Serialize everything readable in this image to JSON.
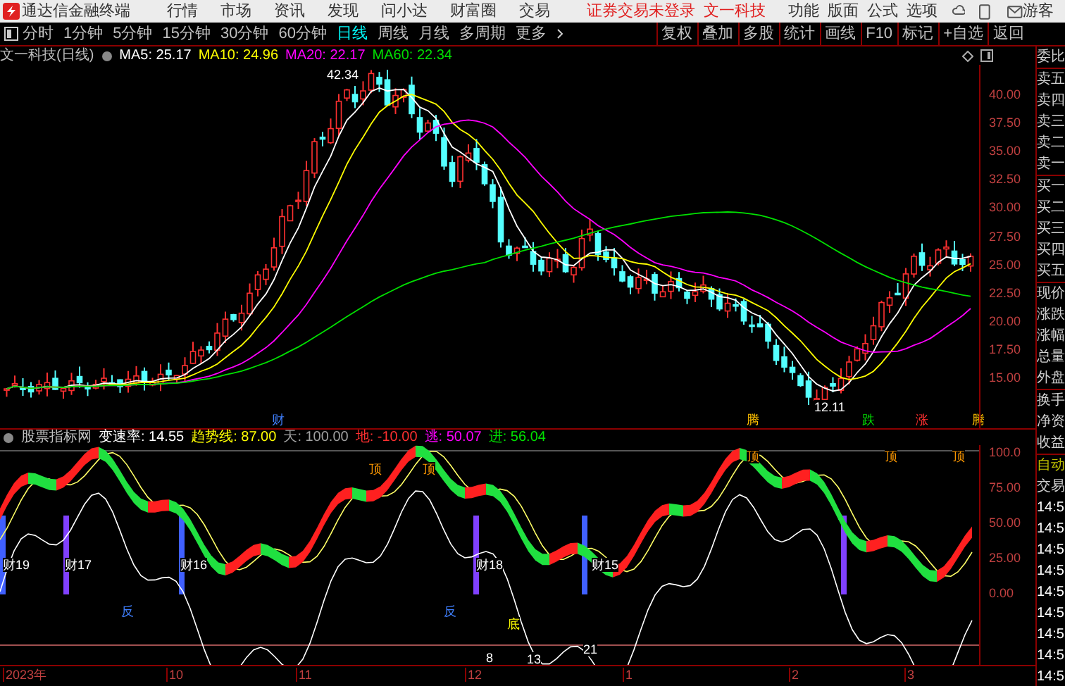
{
  "app": {
    "title": "通达信金融终端",
    "menus": [
      "行情",
      "市场",
      "资讯",
      "发现",
      "问小达",
      "财富圈",
      "交易"
    ],
    "notice": "证券交易未登录",
    "stock": "文一科技",
    "right_menus": [
      "功能",
      "版面",
      "公式",
      "选项"
    ],
    "user": "游客"
  },
  "periods": [
    {
      "label": "分时",
      "selected": false
    },
    {
      "label": "1分钟",
      "selected": false
    },
    {
      "label": "5分钟",
      "selected": false
    },
    {
      "label": "15分钟",
      "selected": false
    },
    {
      "label": "30分钟",
      "selected": false
    },
    {
      "label": "60分钟",
      "selected": false
    },
    {
      "label": "日线",
      "selected": true
    },
    {
      "label": "周线",
      "selected": false
    },
    {
      "label": "月线",
      "selected": false
    },
    {
      "label": "多周期",
      "selected": false
    },
    {
      "label": "更多",
      "selected": false
    }
  ],
  "toolbar": [
    "复权",
    "叠加",
    "多股",
    "统计",
    "画线",
    "F10",
    "标记",
    "+自选",
    "返回"
  ],
  "chart": {
    "title": "文一科技(日线)",
    "ma": [
      {
        "label": "MA5: 25.17",
        "color": "#ffffff"
      },
      {
        "label": "MA10: 24.96",
        "color": "#ffff00"
      },
      {
        "label": "MA20: 22.17",
        "color": "#ff00ff"
      },
      {
        "label": "MA60: 22.34",
        "color": "#00e000"
      }
    ],
    "price_ticks": [
      "40.00",
      "37.50",
      "35.00",
      "32.50",
      "30.00",
      "27.50",
      "25.00",
      "22.50",
      "20.00",
      "17.50",
      "15.00"
    ],
    "annotations": [
      {
        "text": "42.34",
        "color": "#ffffff"
      },
      {
        "text": "12.11",
        "color": "#ffffff"
      },
      {
        "text": "财",
        "color": "#4080ff"
      },
      {
        "text": "腾",
        "color": "#ffc000"
      },
      {
        "text": "跌",
        "color": "#00e000"
      },
      {
        "text": "涨",
        "color": "#ff3030"
      },
      {
        "text": "腾",
        "color": "#ffc000"
      }
    ]
  },
  "indicator": {
    "name": "股票指标网",
    "values": [
      {
        "label": "变速率: 14.55",
        "color": "#ffffff"
      },
      {
        "label": "趋势线: 87.00",
        "color": "#ffff00"
      },
      {
        "label": "天: 100.00",
        "color": "#a0a0a0"
      },
      {
        "label": "地: -10.00",
        "color": "#ff3030"
      },
      {
        "label": "逃: 50.07",
        "color": "#ff00ff"
      },
      {
        "label": "进: 56.04",
        "color": "#00e000"
      }
    ],
    "ticks": [
      "100.0",
      "75.00",
      "50.00",
      "25.00",
      "0.00"
    ],
    "labels": [
      {
        "text": "顶",
        "color": "#ff9900"
      },
      {
        "text": "顶",
        "color": "#ff9900"
      },
      {
        "text": "顶",
        "color": "#ff9900"
      },
      {
        "text": "顶",
        "color": "#ff9900"
      },
      {
        "text": "顶",
        "color": "#ff9900"
      },
      {
        "text": "反",
        "color": "#4080ff"
      },
      {
        "text": "反",
        "color": "#4080ff"
      },
      {
        "text": "底",
        "color": "#ffff00"
      },
      {
        "text": "财19",
        "color": "#ffffff"
      },
      {
        "text": "财17",
        "color": "#ffffff"
      },
      {
        "text": "财16",
        "color": "#ffffff"
      },
      {
        "text": "财18",
        "color": "#ffffff"
      },
      {
        "text": "财15",
        "color": "#ffffff"
      },
      {
        "text": "8",
        "color": "#ffffff"
      },
      {
        "text": "13",
        "color": "#ffffff"
      },
      {
        "text": "21",
        "color": "#ffffff"
      }
    ]
  },
  "dates": [
    "2023年",
    "10",
    "11",
    "12",
    "1",
    "2",
    "3"
  ],
  "quote_panel": {
    "groups": [
      [
        "委比"
      ],
      [
        "卖五",
        "卖四",
        "卖三",
        "卖二",
        "卖一"
      ],
      [
        "买一",
        "买二",
        "买三",
        "买四",
        "买五"
      ],
      [
        "现价",
        "涨跌",
        "涨幅",
        "总量",
        "外盘"
      ],
      [
        "换手",
        "净资",
        "收益"
      ]
    ],
    "mode": [
      "自动",
      "交易"
    ],
    "times": [
      "14:5",
      "14:5",
      "14:5",
      "14:5",
      "14:5",
      "14:5",
      "14:5",
      "14:5",
      "14:5"
    ]
  }
}
